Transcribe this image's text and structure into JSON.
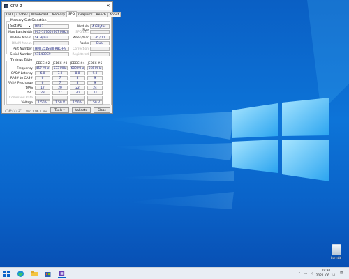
{
  "window": {
    "title": "CPU-Z",
    "tabs": [
      "CPU",
      "Caches",
      "Mainboard",
      "Memory",
      "SPD",
      "Graphics",
      "Bench",
      "About"
    ],
    "active_tab": "SPD",
    "slot_group_title": "Memory Slot Selection",
    "slot_select": "Slot #1",
    "memory_type": "DDR3",
    "module_size_label": "Module Size",
    "module_size": "4 GBytes",
    "max_bw_label": "Max Bandwidth",
    "max_bw": "PC3-10700 (667 MHz)",
    "spd_ext_label": "SPD Ext.",
    "spd_ext": "",
    "manuf_label": "Module Manuf.",
    "manuf": "SK Hynix",
    "weekyear_label": "Week/Year",
    "weekyear": "36 / 11",
    "dram_label": "DRAM Manuf.",
    "dram": "",
    "ranks_label": "Ranks",
    "ranks": "Dual",
    "part_label": "Part Number",
    "part": "HMT351S6BFR8C-H9",
    "correction_label": "Correction",
    "correction": "",
    "serial_label": "Serial Number",
    "serial": "61B4B9C9",
    "registered_label": "Registered",
    "registered": "",
    "timings_title": "Timings Table",
    "timing_columns": [
      "JEDEC #2",
      "JEDEC #3",
      "JEDEC #4",
      "JEDEC #5"
    ],
    "timing_rows": [
      {
        "label": "Frequency",
        "values": [
          "457 MHz",
          "533 MHz",
          "609 MHz",
          "666 MHz"
        ]
      },
      {
        "label": "CAS# Latency",
        "values": [
          "6.0",
          "7.0",
          "8.0",
          "9.0"
        ]
      },
      {
        "label": "RAS# to CAS#",
        "values": [
          "6",
          "7",
          "8",
          "9"
        ]
      },
      {
        "label": "RAS# Precharge",
        "values": [
          "6",
          "7",
          "8",
          "9"
        ]
      },
      {
        "label": "tRAS",
        "values": [
          "17",
          "20",
          "22",
          "24"
        ]
      },
      {
        "label": "tRC",
        "values": [
          "23",
          "27",
          "30",
          "33"
        ]
      },
      {
        "label": "Command Rate",
        "values": [
          "",
          "",
          "",
          ""
        ]
      },
      {
        "label": "Voltage",
        "values": [
          "1.50 V",
          "1.50 V",
          "1.50 V",
          "1.50 V"
        ]
      }
    ],
    "brand": "CPU-Z",
    "version": "Ver. 1.96.1.x64",
    "tools_label": "Tools",
    "validate_label": "Validate",
    "close_label": "Close"
  },
  "desktop": {
    "recycle_label": "Lomtár"
  },
  "taskbar": {
    "time": "19:30",
    "date": "2021. 06. 14."
  },
  "colors": {
    "accent": "#0a63c9",
    "value_text": "#1a237e"
  }
}
